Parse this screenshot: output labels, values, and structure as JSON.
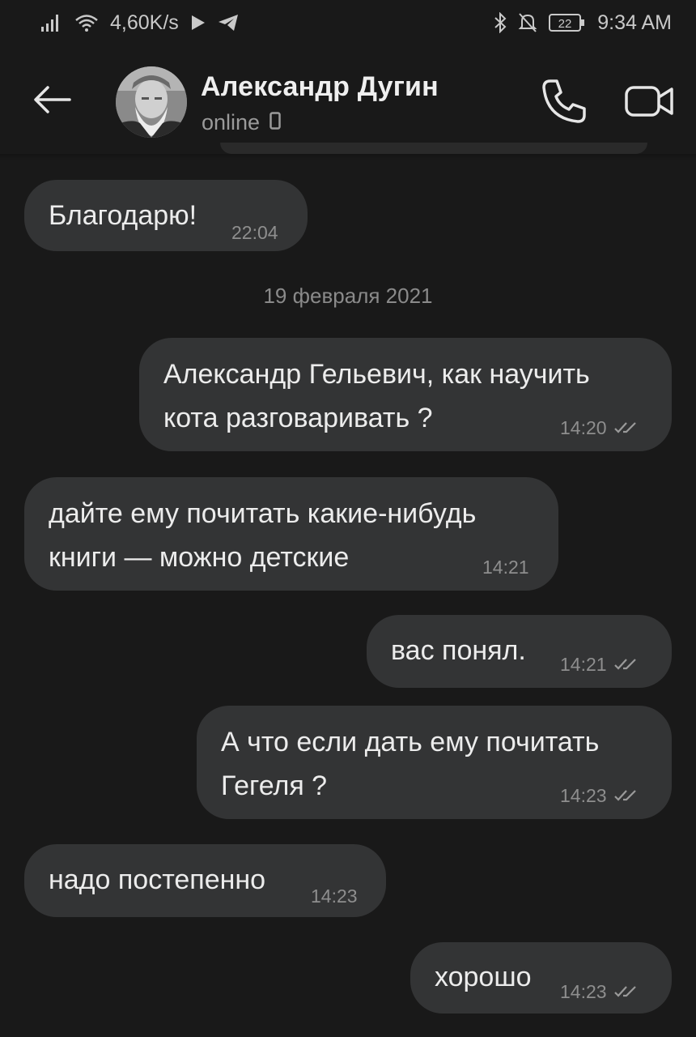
{
  "status_bar": {
    "speed": "4,60K/s",
    "battery": "22",
    "time": "9:34 AM"
  },
  "header": {
    "contact_name": "Александр Дугин",
    "status": "online"
  },
  "date_separator": "19 февраля 2021",
  "messages": [
    {
      "direction": "in",
      "text": "Благодарю!",
      "time": "22:04"
    },
    {
      "direction": "out",
      "text": "Александр Гельевич, как научить\nкота разговаривать ?",
      "time": "14:20",
      "read": true
    },
    {
      "direction": "in",
      "text": "дайте ему почитать какие-нибудь\nкниги — можно детские",
      "time": "14:21"
    },
    {
      "direction": "out",
      "text": "вас понял.",
      "time": "14:21",
      "read": true
    },
    {
      "direction": "out",
      "text": "А что если дать ему почитать\nГегеля ?",
      "time": "14:23",
      "read": true
    },
    {
      "direction": "in",
      "text": "надо постепенно",
      "time": "14:23"
    },
    {
      "direction": "out",
      "text": "хорошо",
      "time": "14:23",
      "read": true
    }
  ],
  "colors": {
    "background": "#191919",
    "bubble": "#333435",
    "meta_text": "#8e8e8e"
  }
}
